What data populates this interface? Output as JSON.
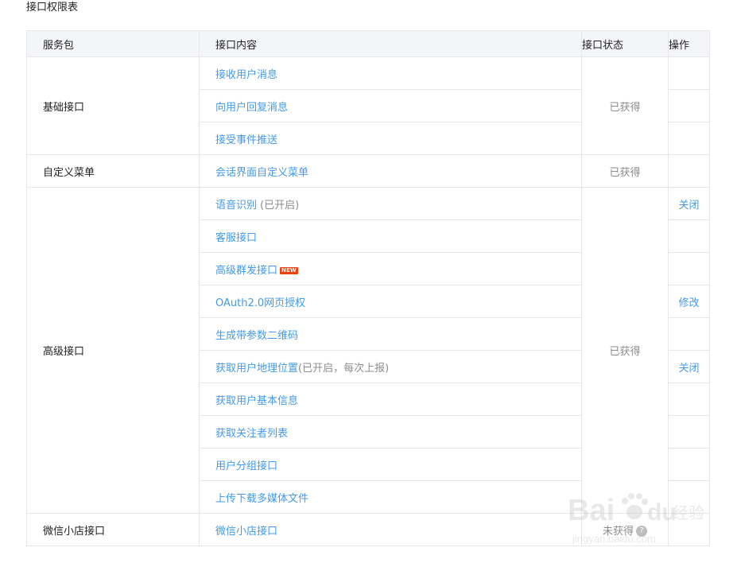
{
  "page": {
    "title": "接口权限表"
  },
  "table": {
    "headers": {
      "package": "服务包",
      "content": "接口内容",
      "status": "接口状态",
      "operation": "操作"
    },
    "groups": [
      {
        "package": "基础接口",
        "status": "已获得",
        "rows": [
          {
            "api": "接收用户消息",
            "note": "",
            "op": ""
          },
          {
            "api": "向用户回复消息",
            "note": "",
            "op": ""
          },
          {
            "api": "接受事件推送",
            "note": "",
            "op": ""
          }
        ]
      },
      {
        "package": "自定义菜单",
        "status": "已获得",
        "rows": [
          {
            "api": "会话界面自定义菜单",
            "note": "",
            "op": ""
          }
        ]
      },
      {
        "package": "高级接口",
        "status": "已获得",
        "rows": [
          {
            "api": "语音识别",
            "note": "(已开启)",
            "op": "关闭"
          },
          {
            "api": "客服接口",
            "note": "",
            "op": ""
          },
          {
            "api": "高级群发接口",
            "note": "",
            "badge": "NEW",
            "op": ""
          },
          {
            "api": "OAuth2.0网页授权",
            "note": "",
            "op": "修改"
          },
          {
            "api": "生成带参数二维码",
            "note": "",
            "op": ""
          },
          {
            "api": "获取用户地理位置",
            "note": "(已开启，每次上报)",
            "op": "关闭"
          },
          {
            "api": "获取用户基本信息",
            "note": "",
            "op": ""
          },
          {
            "api": "获取关注者列表",
            "note": "",
            "op": ""
          },
          {
            "api": "用户分组接口",
            "note": "",
            "op": ""
          },
          {
            "api": "上传下载多媒体文件",
            "note": "",
            "op": ""
          }
        ]
      },
      {
        "package": "微信小店接口",
        "status": "未获得",
        "status_icon": "?",
        "rows": [
          {
            "api": "微信小店接口",
            "note": "",
            "op": ""
          }
        ]
      }
    ]
  },
  "watermark": {
    "text1": "Bai",
    "text2": "du",
    "text3": "经验",
    "url": "jingyan.baidu.com"
  }
}
